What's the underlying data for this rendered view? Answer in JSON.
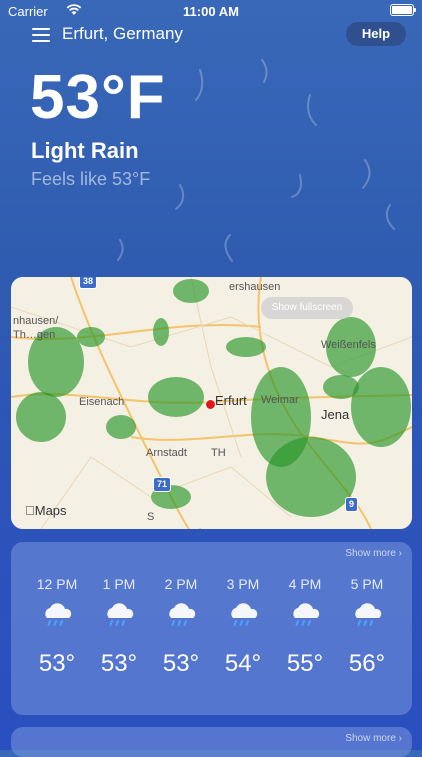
{
  "status_bar": {
    "carrier": "Carrier",
    "time": "11:00 AM"
  },
  "header": {
    "location": "Erfurt, Germany",
    "help_label": "Help"
  },
  "current": {
    "temperature": "53°F",
    "condition": "Light Rain",
    "feels_like": "Feels like 53°F"
  },
  "map": {
    "fullscreen_label": "Show fullscreen",
    "attribution": "Maps",
    "labels": [
      "ershausen",
      "nhausen/",
      "Th…gen",
      "Weißenfels",
      "Eisenach",
      "Erfurt",
      "Weimar",
      "Jena",
      "Arnstadt",
      "TH",
      "S"
    ],
    "road_shields": [
      "38",
      "71",
      "9"
    ]
  },
  "hourly": {
    "show_more": "Show more",
    "hours": [
      {
        "time": "12 PM",
        "icon": "rain-cloud-icon",
        "temp": "53°"
      },
      {
        "time": "1 PM",
        "icon": "rain-cloud-icon",
        "temp": "53°"
      },
      {
        "time": "2 PM",
        "icon": "rain-cloud-icon",
        "temp": "53°"
      },
      {
        "time": "3 PM",
        "icon": "rain-cloud-icon",
        "temp": "54°"
      },
      {
        "time": "4 PM",
        "icon": "rain-cloud-icon",
        "temp": "55°"
      },
      {
        "time": "5 PM",
        "icon": "rain-cloud-icon",
        "temp": "56°"
      }
    ]
  },
  "second_card": {
    "show_more": "Show more"
  }
}
